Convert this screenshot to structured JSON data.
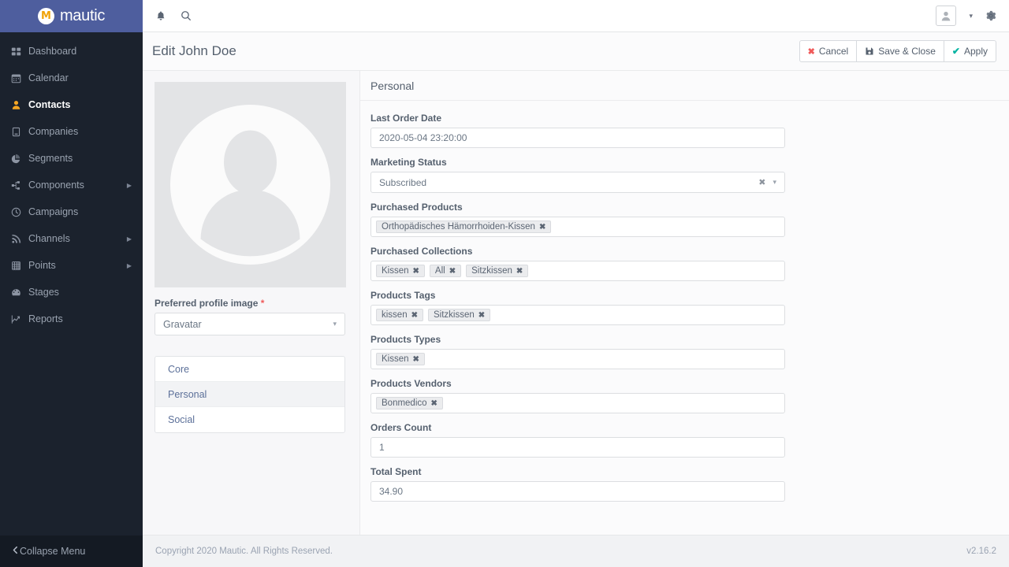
{
  "brand": {
    "name": "mautic",
    "logo_letter": "M",
    "logo_color": "#f0a30a",
    "bar_color": "#4e5e9e"
  },
  "sidebar": {
    "items": [
      {
        "label": "Dashboard",
        "icon": "dashboard-icon",
        "active": false,
        "caret": false
      },
      {
        "label": "Calendar",
        "icon": "calendar-icon",
        "active": false,
        "caret": false
      },
      {
        "label": "Contacts",
        "icon": "contacts-icon",
        "active": true,
        "caret": false
      },
      {
        "label": "Companies",
        "icon": "companies-icon",
        "active": false,
        "caret": false
      },
      {
        "label": "Segments",
        "icon": "segments-icon",
        "active": false,
        "caret": false
      },
      {
        "label": "Components",
        "icon": "components-icon",
        "active": false,
        "caret": true
      },
      {
        "label": "Campaigns",
        "icon": "campaigns-icon",
        "active": false,
        "caret": false
      },
      {
        "label": "Channels",
        "icon": "channels-icon",
        "active": false,
        "caret": true
      },
      {
        "label": "Points",
        "icon": "points-icon",
        "active": false,
        "caret": true
      },
      {
        "label": "Stages",
        "icon": "stages-icon",
        "active": false,
        "caret": false
      },
      {
        "label": "Reports",
        "icon": "reports-icon",
        "active": false,
        "caret": false
      }
    ],
    "collapse": {
      "label": "Collapse Menu",
      "icon": "chevron-left-icon"
    }
  },
  "topbar": {
    "notifications_icon": "bell-icon",
    "search_icon": "search-icon",
    "avatar_icon": "user-avatar-icon",
    "dropdown_caret": "▾",
    "settings_icon": "gear-icon"
  },
  "pageheader": {
    "title": "Edit John Doe",
    "buttons": [
      {
        "label": "Cancel",
        "icon": "x-icon",
        "icon_glyph": "✖",
        "color": "#f05a5a"
      },
      {
        "label": "Save & Close",
        "icon": "floppy-disk-icon",
        "icon_glyph": "",
        "color": "#55606e"
      },
      {
        "label": "Apply",
        "icon": "check-icon",
        "icon_glyph": "✔",
        "color": "#00b3a1"
      }
    ]
  },
  "left_panel": {
    "avatar_alt": "profile-placeholder",
    "profile_image_label": "Preferred profile image",
    "required_marker": "*",
    "profile_image_value": "Gravatar",
    "tabs": [
      {
        "label": "Core",
        "active": false
      },
      {
        "label": "Personal",
        "active": true
      },
      {
        "label": "Social",
        "active": false
      }
    ]
  },
  "form": {
    "section_title": "Personal",
    "fields": [
      {
        "type": "text",
        "label": "Last Order Date",
        "value": "2020-05-04 23:20:00"
      },
      {
        "type": "select",
        "label": "Marketing Status",
        "value": "Subscribed",
        "clearable": true
      },
      {
        "type": "tags",
        "label": "Purchased Products",
        "tags": [
          "Orthopädisches Hämorrhoiden-Kissen"
        ]
      },
      {
        "type": "tags",
        "label": "Purchased Collections",
        "tags": [
          "Kissen",
          "All",
          "Sitzkissen"
        ]
      },
      {
        "type": "tags",
        "label": "Products Tags",
        "tags": [
          "kissen",
          "Sitzkissen"
        ]
      },
      {
        "type": "tags",
        "label": "Products Types",
        "tags": [
          "Kissen"
        ]
      },
      {
        "type": "tags",
        "label": "Products Vendors",
        "tags": [
          "Bonmedico"
        ]
      },
      {
        "type": "text",
        "label": "Orders Count",
        "value": "1"
      },
      {
        "type": "text",
        "label": "Total Spent",
        "value": "34.90"
      }
    ]
  },
  "footer": {
    "copyright": "Copyright 2020 Mautic. All Rights Reserved.",
    "version": "v2.16.2"
  }
}
